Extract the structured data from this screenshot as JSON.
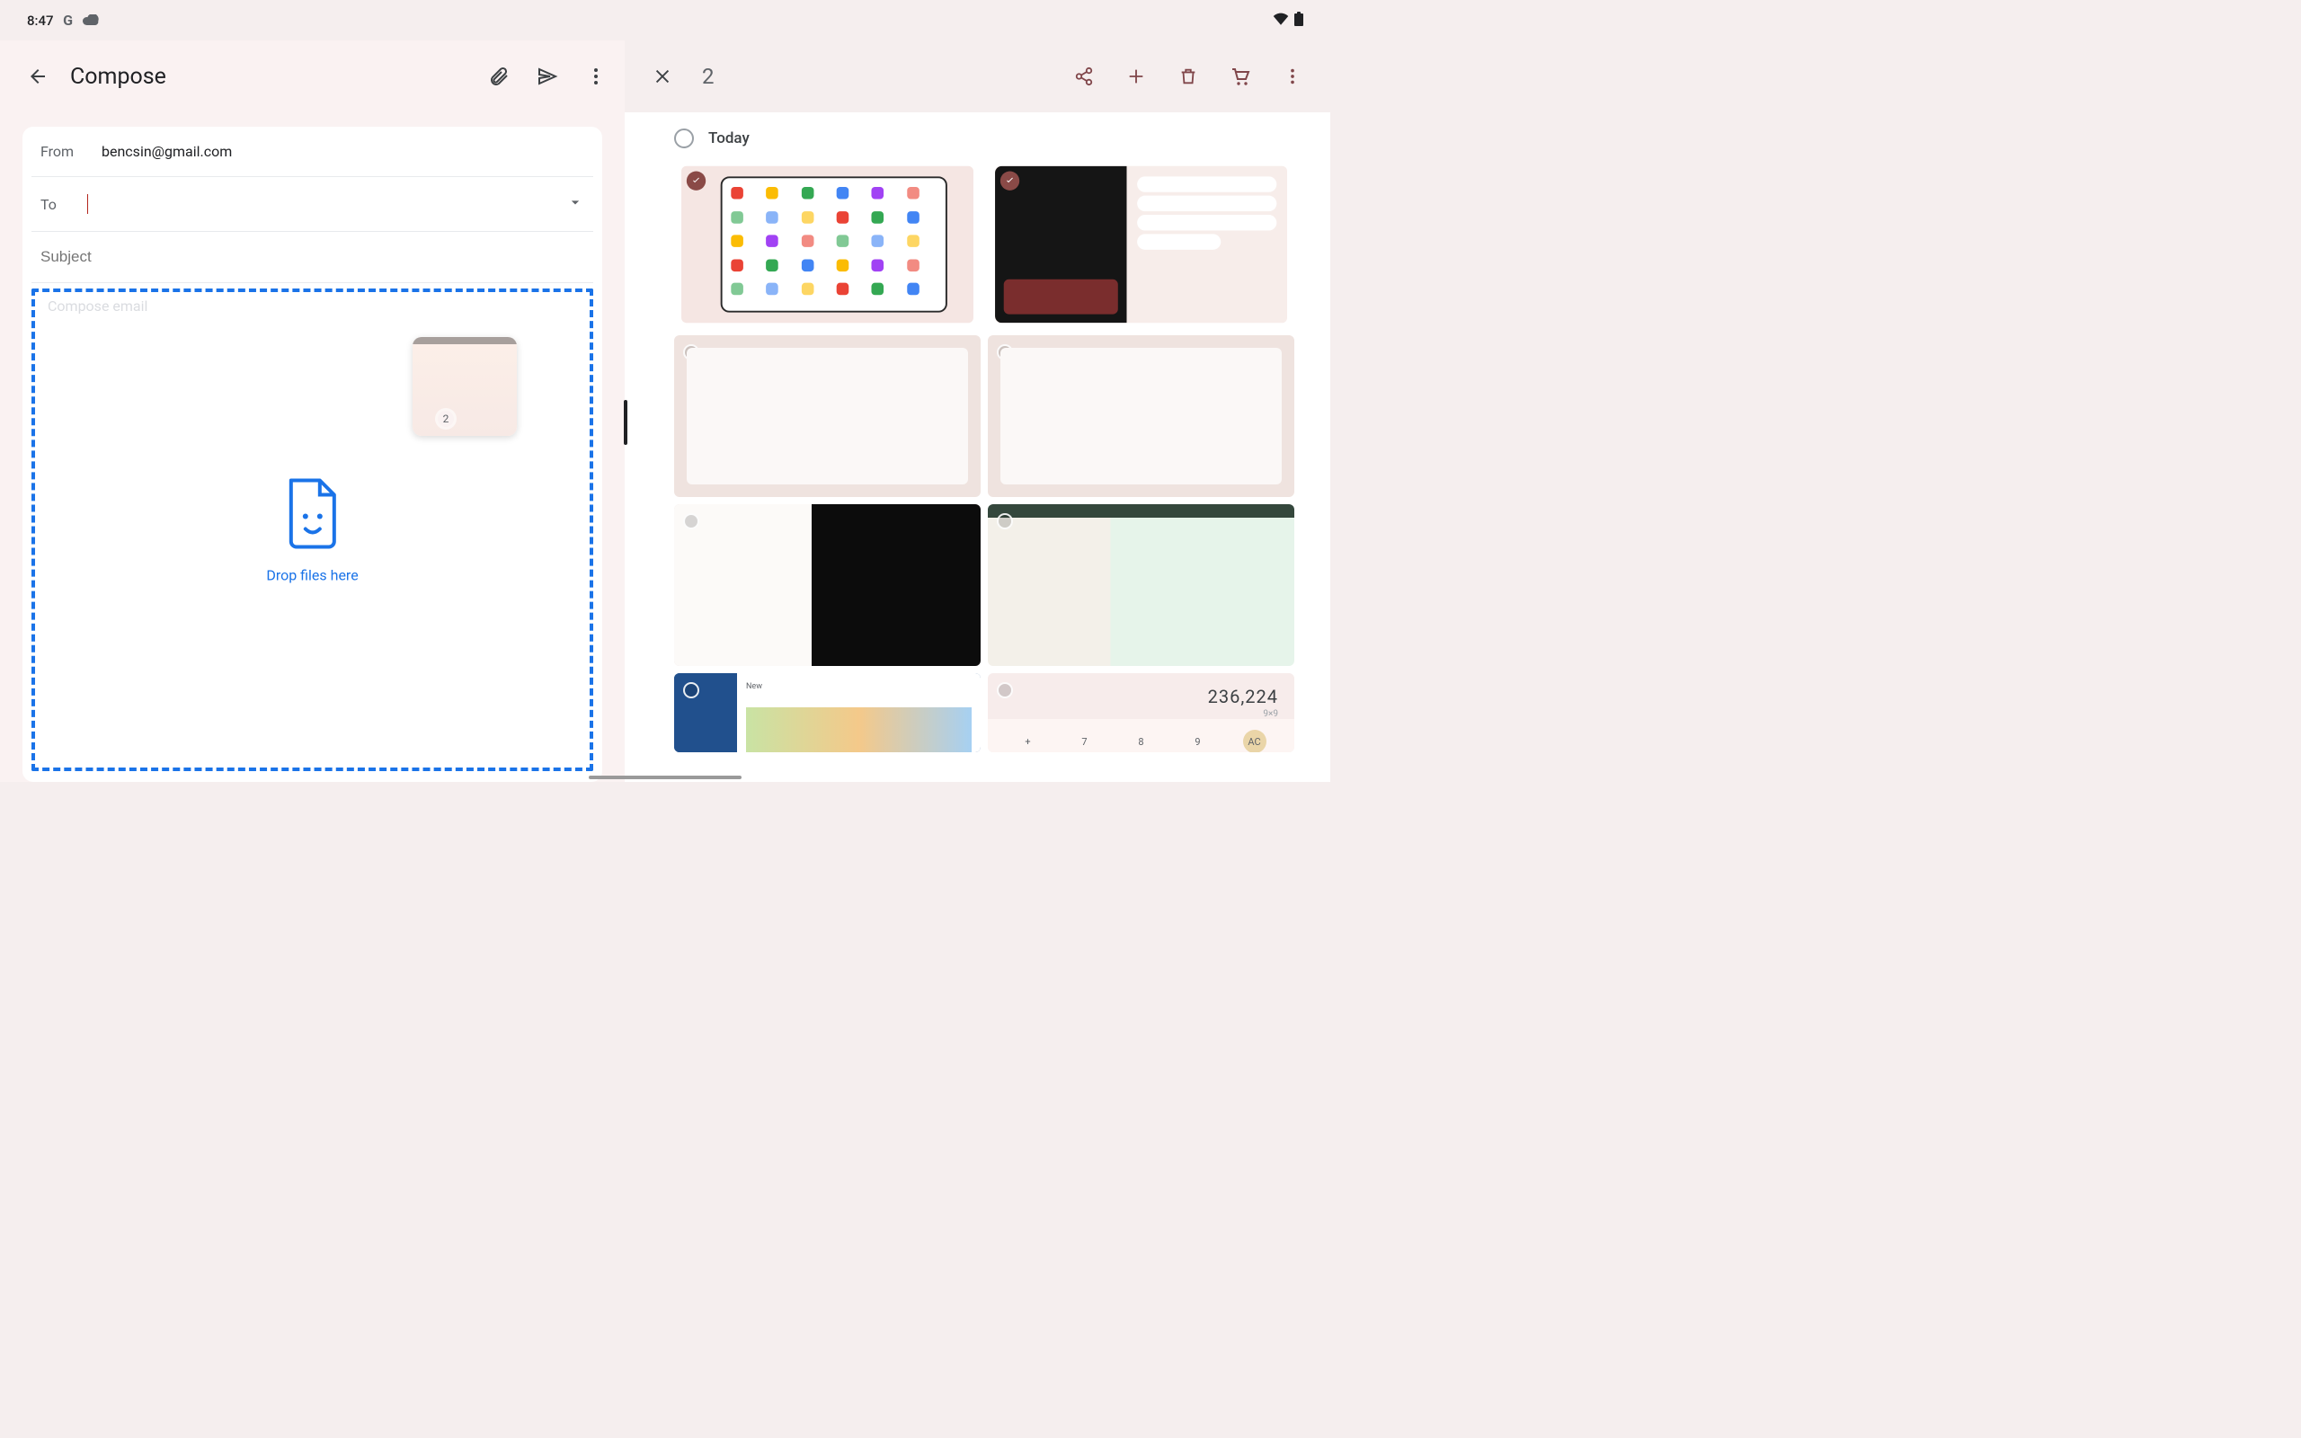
{
  "status": {
    "time": "8:47"
  },
  "compose": {
    "title": "Compose",
    "from_label": "From",
    "from_value": "bencsin@gmail.com",
    "to_label": "To",
    "subject_placeholder": "Subject",
    "body_placeholder": "Compose email",
    "drop_hint": "Drop files here",
    "drag_badge": "2"
  },
  "photos": {
    "selected_count": "2",
    "section": "Today",
    "calc_display": "236,224",
    "calc_sub": "9×9",
    "tiles": [
      {
        "selected": true
      },
      {
        "selected": true
      },
      {
        "selected": false
      },
      {
        "selected": false
      },
      {
        "selected": false
      },
      {
        "selected": false
      },
      {
        "selected": false
      },
      {
        "selected": false
      }
    ]
  }
}
